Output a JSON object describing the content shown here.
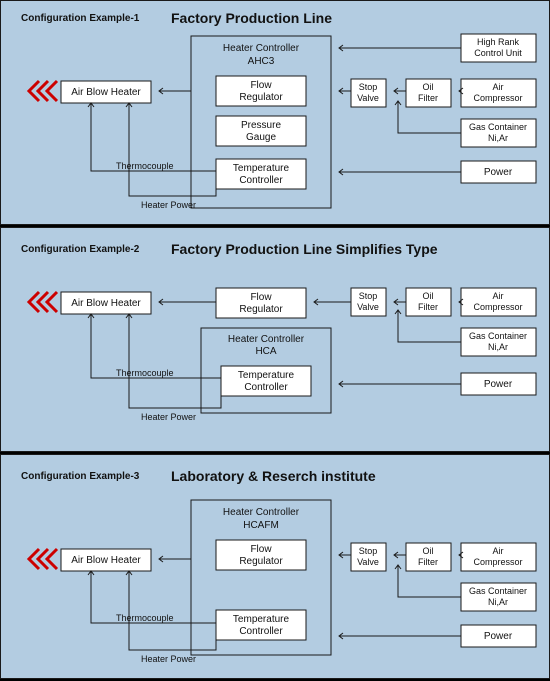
{
  "panels": [
    {
      "subtitle": "Configuration Example-1",
      "title": "Factory Production Line",
      "controller_top": "Heater Controller",
      "controller_bottom": "AHC3",
      "inner_boxes": [
        "Flow Regulator",
        "Pressure Gauge",
        "Temperature Controller"
      ],
      "air_blow": "Air Blow Heater",
      "stop_valve": "Stop Valve",
      "oil_filter": "Oil Filter",
      "air_comp": "Air Compressor",
      "gas": "Gas Container Ni,Ar",
      "power": "Power",
      "high_rank": "High Rank Control Unit",
      "thermo": "Thermocouple",
      "heater_power": "Heater Power"
    },
    {
      "subtitle": "Configuration Example-2",
      "title": "Factory Production Line Simplifies Type",
      "controller_top": "Heater Controller",
      "controller_bottom": "HCA",
      "flow_reg": "Flow Regulator",
      "temp_ctrl": "Temperature Controller",
      "air_blow": "Air Blow Heater",
      "stop_valve": "Stop Valve",
      "oil_filter": "Oil Filter",
      "air_comp": "Air Compressor",
      "gas": "Gas Container Ni,Ar",
      "power": "Power",
      "thermo": "Thermocouple",
      "heater_power": "Heater Power"
    },
    {
      "subtitle": "Configuration Example-3",
      "title": "Laboratory & Reserch institute",
      "controller_top": "Heater Controller",
      "controller_bottom": "HCAFM",
      "inner_boxes": [
        "Flow Regulator",
        "Temperature Controller"
      ],
      "air_blow": "Air Blow Heater",
      "stop_valve": "Stop Valve",
      "oil_filter": "Oil Filter",
      "air_comp": "Air Compressor",
      "gas": "Gas Container Ni,Ar",
      "power": "Power",
      "thermo": "Thermocouple",
      "heater_power": "Heater Power"
    }
  ]
}
